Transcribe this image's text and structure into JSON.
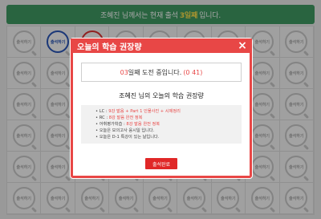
{
  "banner": {
    "prefix": "조혜진 님께서는 현재 출석",
    "count": "3일째",
    "suffix": "입니다."
  },
  "stamp_label": "출석하기",
  "modal": {
    "title": "오늘의 학습 권장량",
    "close_icon": "×",
    "status": {
      "day": "03",
      "text": "일째 도전 중입니다.",
      "progress": "(0 41)"
    },
    "rec_title": "조혜진 님의 오늘의 학습 권장량",
    "items": [
      {
        "label": "LC :",
        "value": "9강 발음 + Part 1 인물사진 + 시제정리"
      },
      {
        "label": "RC :",
        "value": "8강 발음 완전 정복"
      },
      {
        "label": "어휘평가학습 :",
        "value": "8강 발음 완전 정복"
      },
      {
        "label": "",
        "value": "오늘은 모의고사 응시일 입니다."
      },
      {
        "label": "",
        "value": "오늘은 D-1 특강이 있는 날입니다."
      }
    ],
    "done_label": "출석완료"
  },
  "colors": {
    "banner": "#3f9a63",
    "modal_accent": "#e84746",
    "button": "#e02727"
  }
}
